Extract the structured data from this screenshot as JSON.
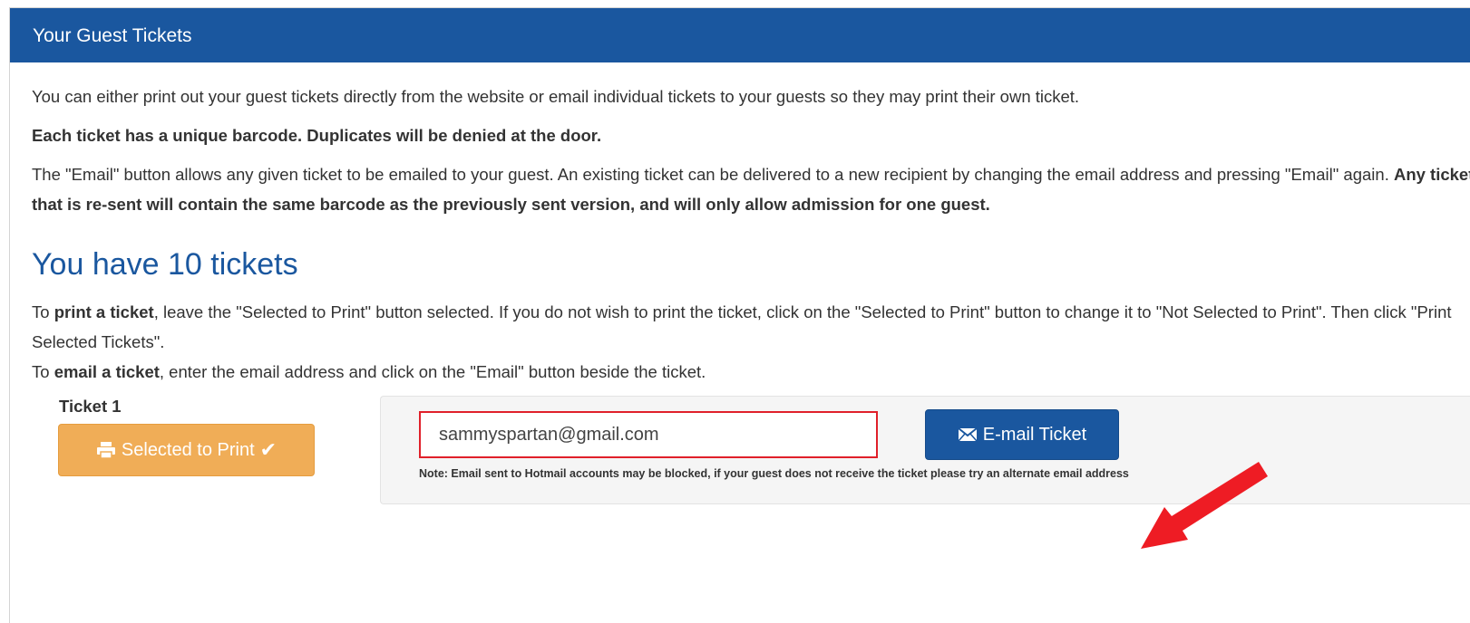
{
  "panel": {
    "title": "Your Guest Tickets"
  },
  "intro": "You can either print out your guest tickets directly from the website or email individual tickets to your guests so they may print their own ticket.",
  "warning": "Each ticket has a unique barcode. Duplicates will be denied at the door.",
  "email_info": {
    "text": "The \"Email\" button allows any given ticket to be emailed to your guest. An existing ticket can be delivered to a new recipient by changing the email address and pressing \"Email\" again. ",
    "bold": "Any ticket that is re-sent will contain the same barcode as the previously sent version, and will only allow admission for one guest."
  },
  "heading": "You have 10 tickets",
  "instructions": {
    "print_prefix": "To ",
    "print_bold": "print a ticket",
    "print_text": ", leave the \"Selected to Print\" button selected. If you do not wish to print the ticket, click on the \"Selected to Print\" button to change it to \"Not Selected to Print\". Then click \"Print Selected Tickets\".",
    "email_prefix": "To ",
    "email_bold": "email a ticket",
    "email_text": ", enter the email address and click on the \"Email\" button beside the ticket."
  },
  "ticket": {
    "label": "Ticket 1",
    "print_button": "Selected to Print",
    "email_value": "sammyspartan@gmail.com",
    "email_button": "E-mail Ticket",
    "note": "Note: Email sent to Hotmail accounts may be blocked, if your guest does not receive the ticket please try an alternate email address"
  },
  "colors": {
    "primary": "#1a579f",
    "print_button": "#f0ad57",
    "highlight": "#e0202a",
    "arrow": "#ee1c24"
  },
  "icons": {
    "print": "printer-icon",
    "check": "check-icon",
    "email": "envelope-icon",
    "annotation": "red-arrow-icon"
  }
}
